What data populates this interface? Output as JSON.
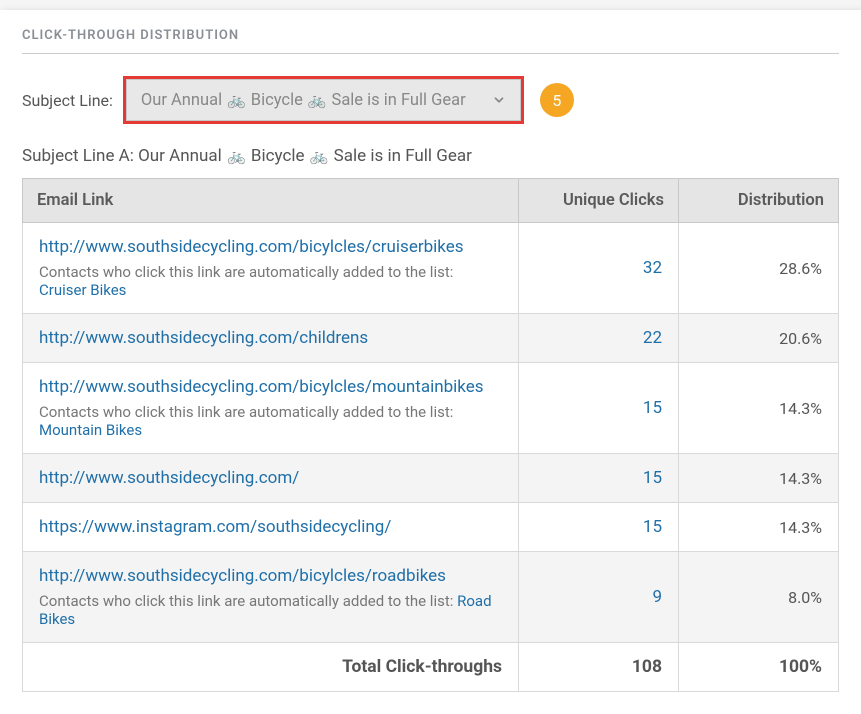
{
  "section_title": "CLICK-THROUGH DISTRIBUTION",
  "control": {
    "label": "Subject Line:",
    "selected_prefix": "Our Annual",
    "selected_mid": "Bicycle",
    "selected_suffix": "Sale is in Full Gear",
    "badge": "5"
  },
  "heading": {
    "prefix": "Subject Line A: Our Annual",
    "mid": "Bicycle",
    "suffix": "Sale is in Full Gear"
  },
  "table": {
    "col_link": "Email Link",
    "col_clicks": "Unique Clicks",
    "col_dist": "Distribution",
    "autolist_prefix": "Contacts who click this link are automatically added to the list:",
    "rows": [
      {
        "url": "http://www.southsidecycling.com/bicylcles/cruiserbikes",
        "list": "Cruiser Bikes",
        "clicks": "32",
        "dist": "28.6%"
      },
      {
        "url": "http://www.southsidecycling.com/childrens",
        "list": null,
        "clicks": "22",
        "dist": "20.6%"
      },
      {
        "url": "http://www.southsidecycling.com/bicylcles/mountainbikes",
        "list": "Mountain Bikes",
        "clicks": "15",
        "dist": "14.3%"
      },
      {
        "url": "http://www.southsidecycling.com/",
        "list": null,
        "clicks": "15",
        "dist": "14.3%"
      },
      {
        "url": "https://www.instagram.com/southsidecycling/",
        "list": null,
        "clicks": "15",
        "dist": "14.3%"
      },
      {
        "url": "http://www.southsidecycling.com/bicylcles/roadbikes",
        "list": "Road Bikes",
        "clicks": "9",
        "dist": "8.0%"
      }
    ],
    "total_label": "Total Click-throughs",
    "total_clicks": "108",
    "total_dist": "100%"
  }
}
